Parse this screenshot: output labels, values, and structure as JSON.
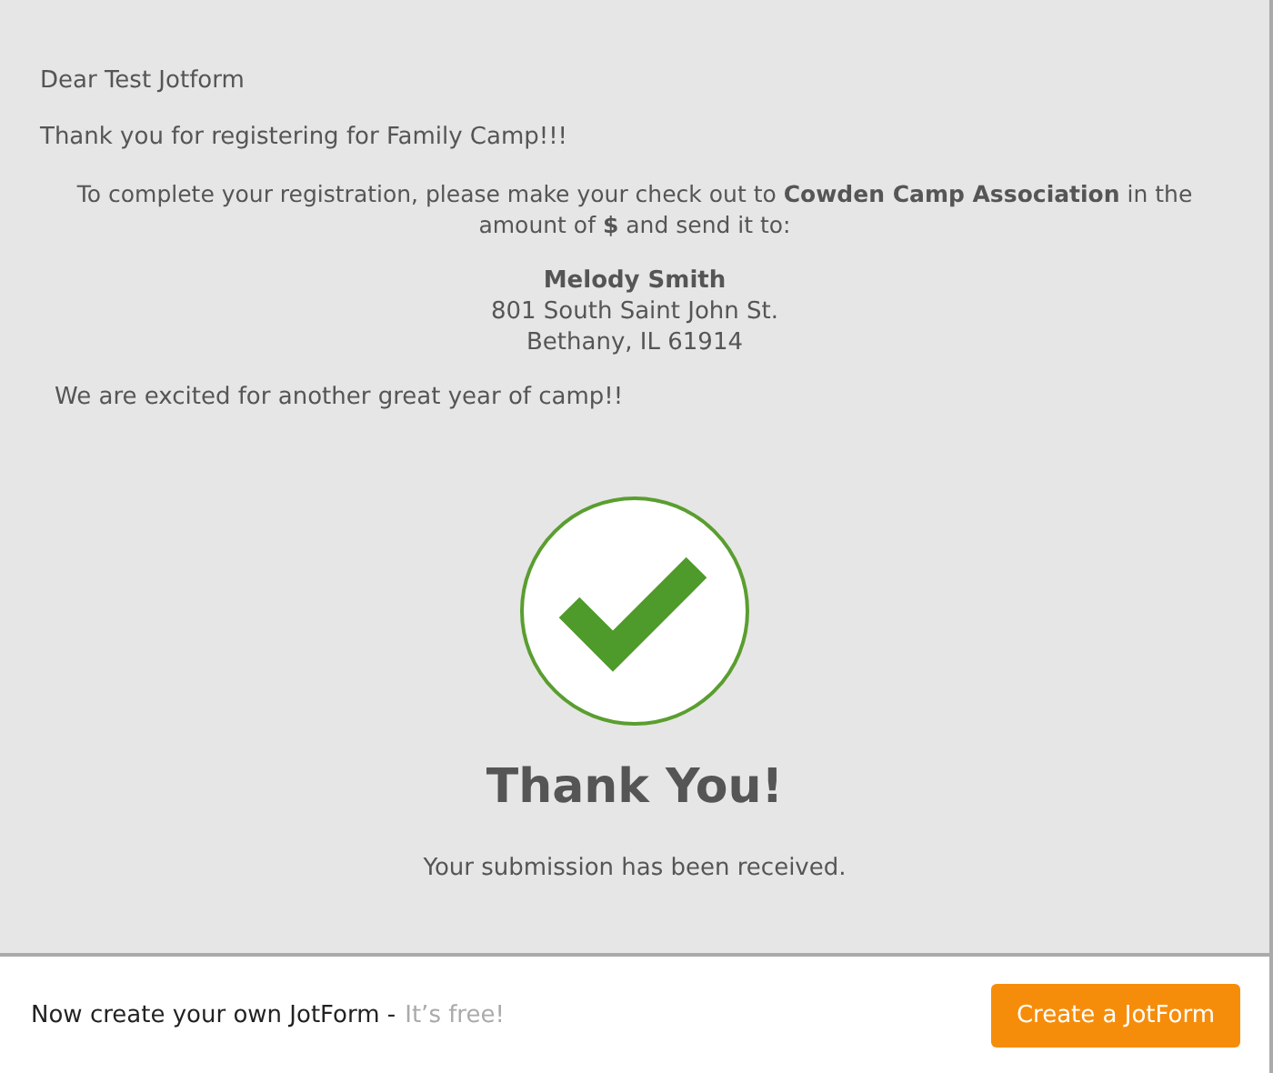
{
  "message": {
    "greeting": "Dear Test Jotform",
    "thanks": "Thank you for registering for Family Camp!!!",
    "instructions": "To complete your registration, please make your check out to **Cowden Camp Association** in the amount of **$** and send it to:",
    "address": {
      "name": "Melody Smith",
      "street": "801 South Saint John St.",
      "city": "Bethany, IL 61914"
    },
    "closing": "We are excited for another great year of camp!!"
  },
  "confirmation": {
    "title": "Thank You!",
    "subtitle": "Your submission has been received."
  },
  "footer": {
    "text": "Now create your own JotForm -",
    "note": "It’s free!",
    "button": "Create a JotForm"
  }
}
